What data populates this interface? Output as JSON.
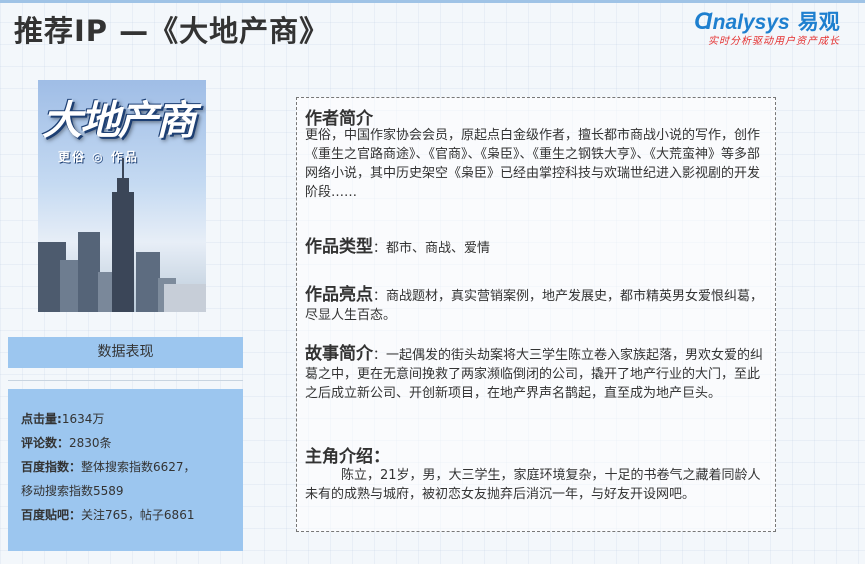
{
  "header": {
    "title": "推荐IP —《大地产商》",
    "logo_brand": "nalysys",
    "logo_brand_cn": "易观",
    "logo_tagline": "实时分析驱动用户资产成长"
  },
  "cover": {
    "title": "大地产商",
    "author_line": "更俗 ◎ 作品"
  },
  "data_panel": {
    "heading": "数据表现",
    "stats": [
      {
        "label": "点击量:",
        "value": "1634万"
      },
      {
        "label": "评论数：",
        "value": "2830条"
      },
      {
        "label": "百度指数：",
        "value": "整体搜索指数6627，"
      },
      {
        "label": "",
        "value": "移动搜索指数5589"
      },
      {
        "label": "百度贴吧：",
        "value": "关注765，帖子6861"
      }
    ]
  },
  "content": {
    "author_heading": "作者简介",
    "author_text": "更俗，中国作家协会会员，原起点白金级作者，擅长都市商战小说的写作，创作《重生之官路商途》、《官商》、《枭臣》、《重生之钢铁大亨》、《大荒蛮神》等多部网络小说，其中历史架空《枭臣》已经由掌控科技与欢瑞世纪进入影视剧的开发阶段……",
    "genre_heading": "作品类型",
    "genre_text": "：都市、商战、爱情",
    "highlight_heading": "作品亮点",
    "highlight_text": "：商战题材，真实营销案例，地产发展史，都市精英男女爱恨纠葛，尽显人生百态。",
    "story_heading": "故事简介",
    "story_text": "：一起偶发的街头劫案将大三学生陈立卷入家族起落，男欢女爱的纠葛之中，更在无意间挽救了两家濒临倒闭的公司，撬开了地产行业的大门，至此之后成立新公司、开创新项目，在地产界声名鹊起，直至成为地产巨头。",
    "lead_heading": "主角介绍：",
    "lead_text": "陈立，21岁，男，大三学生，家庭环境复杂，十足的书卷气之藏着同龄人未有的成熟与城府，被初恋女友抛弃后消沉一年，与好友开设网吧。"
  }
}
